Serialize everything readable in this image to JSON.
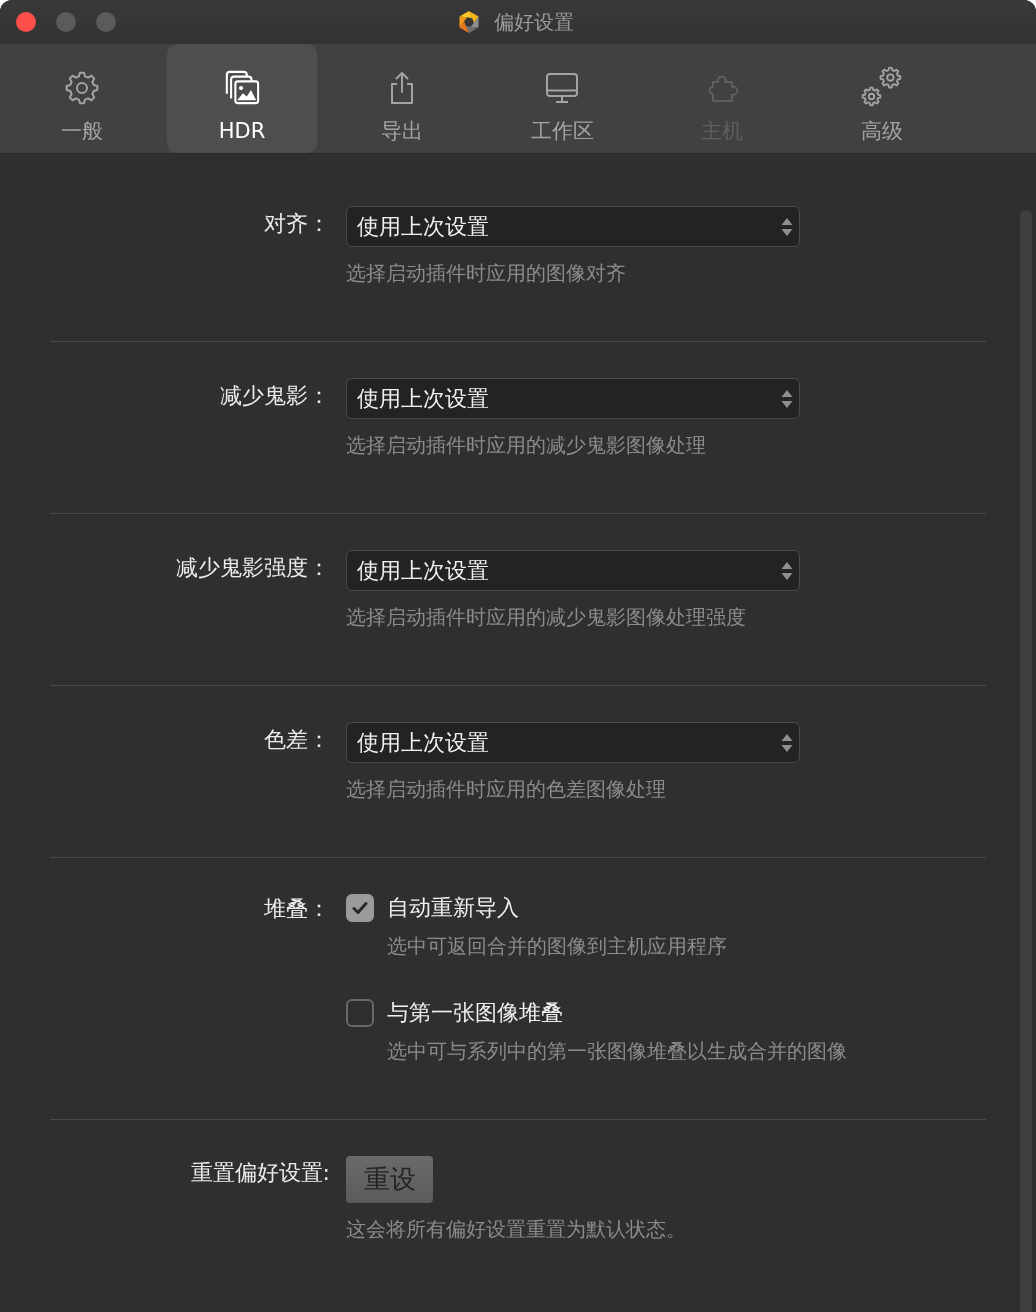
{
  "window": {
    "title": "偏好设置"
  },
  "tabs": [
    {
      "label": "一般",
      "selected": false,
      "disabled": false
    },
    {
      "label": "HDR",
      "selected": true,
      "disabled": false
    },
    {
      "label": "导出",
      "selected": false,
      "disabled": false
    },
    {
      "label": "工作区",
      "selected": false,
      "disabled": false
    },
    {
      "label": "主机",
      "selected": false,
      "disabled": true
    },
    {
      "label": "高级",
      "selected": false,
      "disabled": false
    }
  ],
  "settings": [
    {
      "kind": "select",
      "label": "对齐：",
      "value": "使用上次设置",
      "description": "选择启动插件时应用的图像对齐"
    },
    {
      "kind": "select",
      "label": "减少鬼影：",
      "value": "使用上次设置",
      "description": "选择启动插件时应用的减少鬼影图像处理"
    },
    {
      "kind": "select",
      "label": "减少鬼影强度：",
      "value": "使用上次设置",
      "description": "选择启动插件时应用的减少鬼影图像处理强度"
    },
    {
      "kind": "select",
      "label": "色差：",
      "value": "使用上次设置",
      "description": "选择启动插件时应用的色差图像处理"
    },
    {
      "kind": "checkboxes",
      "label": "堆叠：",
      "options": [
        {
          "label": "自动重新导入",
          "checked": true,
          "description": "选中可返回合并的图像到主机应用程序"
        },
        {
          "label": "与第一张图像堆叠",
          "checked": false,
          "description": "选中可与系列中的第一张图像堆叠以生成合并的图像"
        }
      ]
    },
    {
      "kind": "button",
      "label": "重置偏好设置:",
      "button": "重设",
      "description": "这会将所有偏好设置重置为默认状态。"
    }
  ]
}
